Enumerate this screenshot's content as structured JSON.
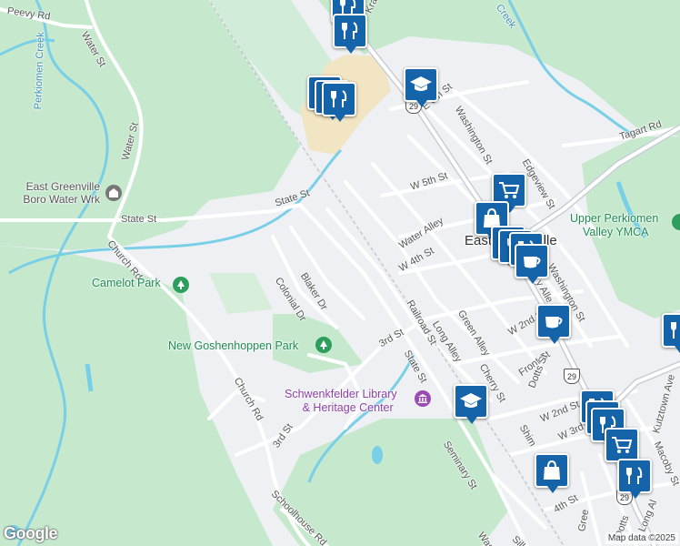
{
  "streets": {
    "peevy_rd": "Peevy Rd",
    "water_st_1": "Water St",
    "water_st_2": "Water St",
    "state_st_1": "State St",
    "state_st_2": "State St",
    "state_st_3": "State St",
    "church_rd_1": "Church Rd",
    "church_rd_2": "Church Rd",
    "colonial_dr": "Colonial Dr",
    "blaker_dr": "Blaker Dr",
    "third_st_1": "3rd St",
    "third_st_2": "3rd St",
    "w_3rd_st": "W 3rd St",
    "schoolhouse_rd": "Schoolhouse Rd",
    "seminary_st": "Seminary St",
    "railroad_st": "Railroad St",
    "long_alley_1": "Long Alley",
    "long_alley_2": "Long Al",
    "green_alley": "Green Alley",
    "cherry_st": "Cherry St",
    "front_st": "Front St",
    "dotts_st": "Dotts St",
    "dotts_st_2": "Dotts",
    "w_2nd_st_1": "W 2nd St",
    "w_2nd_st_2": "W 2nd St",
    "w_4th_st": "W 4th St",
    "fourth_st": "4th St",
    "water_alley": "Water Alley",
    "w_5th_st": "W 5th St",
    "e_6th_st": "E 6th St",
    "washington_st_1": "Washington St",
    "washington_st_2": "Washington St",
    "edgeview_st": "Edgeview St",
    "tagart_rd": "Tagart Rd",
    "kutztown_ave": "Kutztown Ave",
    "macoby_st": "Macoby St",
    "silk_a": "Silk A",
    "washi": "Washi",
    "shim": "Shim",
    "gree": "Gree",
    "kra": "Kra",
    "y_alle": "y Alle",
    "creek": "Creek"
  },
  "routes": {
    "route_29a": "29",
    "route_29b": "29",
    "route_29c": "29"
  },
  "pois": {
    "water_works_line1": "East Greenville",
    "water_works_line2": "Boro Water Wrk",
    "perkiomen_creek": "Perkiomen Creek",
    "camelot_park": "Camelot Park",
    "new_goshenhoppen_park": "New Goshenhoppen Park",
    "schwenkfelder_line1": "Schwenkfelder Library",
    "schwenkfelder_line2": "& Heritage Center",
    "ymca_line1": "Upper Perkiomen",
    "ymca_line2": "Valley YMCA",
    "town": "East Greenville",
    "town_left": "Eas"
  },
  "branding": {
    "logo": "Google",
    "attribution": "Map data ©2025"
  },
  "colors": {
    "water": "#79cfe6",
    "park": "#c6e9ce",
    "pin": "#1563a8"
  }
}
